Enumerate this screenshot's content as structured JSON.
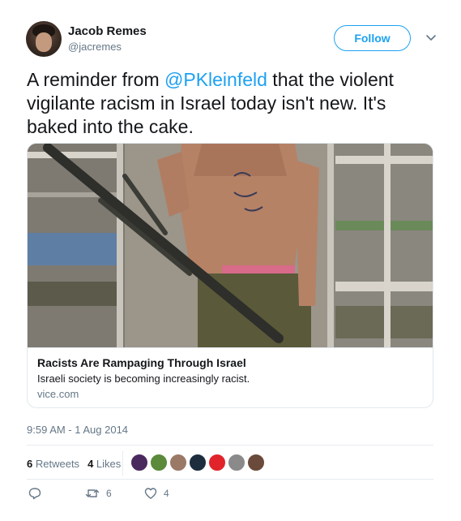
{
  "author": {
    "name": "Jacob Remes",
    "handle": "@jacremes"
  },
  "follow_label": "Follow",
  "tweet": {
    "text_before": "A reminder from ",
    "mention": "@PKleinfeld",
    "text_after": " that the violent vigilante racism in Israel today isn't new. It's baked into the cake."
  },
  "card": {
    "title": "Racists Are Rampaging Through Israel",
    "description": "Israeli society is becoming increasingly racist.",
    "domain": "vice.com"
  },
  "timestamp": "9:59 AM - 1 Aug 2014",
  "stats": {
    "retweets_count": "6",
    "retweets_label": "Retweets",
    "likes_count": "4",
    "likes_label": "Likes"
  },
  "liker_avatars": [
    {
      "color": "#4a2a5e"
    },
    {
      "color": "#5a8a3a"
    },
    {
      "color": "#9a7a66"
    },
    {
      "color": "#1d2d3d"
    },
    {
      "color": "#e0242a"
    },
    {
      "color": "#8a8a8a"
    },
    {
      "color": "#6a4a3a"
    }
  ],
  "actions": {
    "reply_count": "",
    "retweet_count": "6",
    "like_count": "4"
  },
  "colors": {
    "accent": "#1da1f2",
    "secondary_text": "#657786",
    "text": "#14171a",
    "border": "#e1e8ed"
  }
}
